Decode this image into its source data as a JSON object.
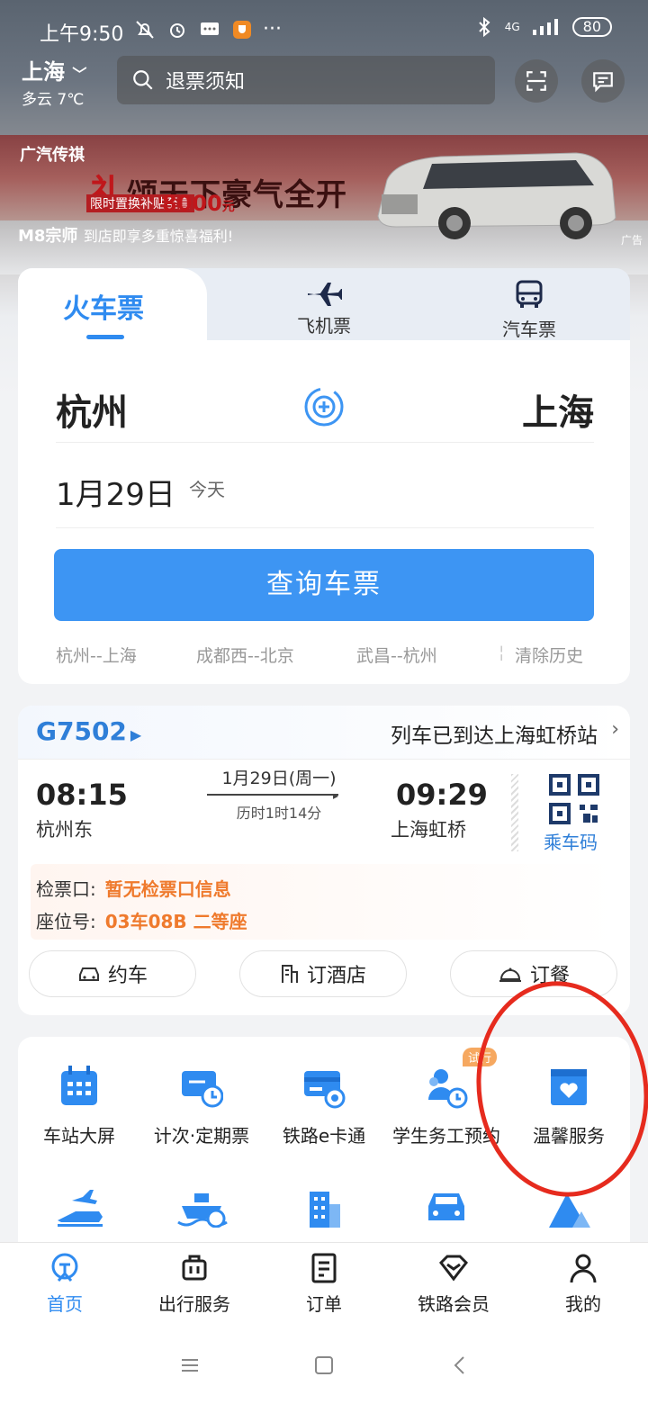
{
  "status": {
    "time": "上午9:50",
    "network": "4G",
    "battery": "80"
  },
  "header": {
    "city": "上海",
    "weather": "多云 7℃",
    "search_placeholder": "退票须知"
  },
  "ad": {
    "brand": "广汽传祺",
    "headline_first": "礼",
    "headline_rest": "颂天下豪气全开",
    "sub": "限时置换补贴至高",
    "amount": "8000",
    "unit": "元",
    "model": "M8宗师",
    "model_tagline": "到店即享多重惊喜福利!",
    "tag": "广告"
  },
  "ticket_tabs": {
    "train": "火车票",
    "plane": "飞机票",
    "bus": "汽车票"
  },
  "search_form": {
    "from": "杭州",
    "to": "上海",
    "date": "1月29日",
    "date_note": "今天",
    "query_button": "查询车票",
    "history": [
      "杭州--上海",
      "成都西--北京",
      "武昌--杭州"
    ],
    "clear_history": "清除历史"
  },
  "trip": {
    "train_no": "G7502",
    "status": "列车已到达上海虹桥站",
    "dep_time": "08:15",
    "dep_station": "杭州东",
    "date": "1月29日(周一)",
    "duration": "历时1时14分",
    "arr_time": "09:29",
    "arr_station": "上海虹桥",
    "qr_label": "乘车码",
    "gate_label": "检票口:",
    "gate_value": "暂无检票口信息",
    "seat_label": "座位号:",
    "seat_value": "03车08B 二等座",
    "actions": [
      "约车",
      "订酒店",
      "订餐"
    ]
  },
  "services": {
    "items": [
      "车站大屏",
      "计次·定期票",
      "铁路e卡通",
      "学生务工预约",
      "温馨服务"
    ],
    "trial_badge": "试行"
  },
  "bottom_nav": [
    "首页",
    "出行服务",
    "订单",
    "铁路会员",
    "我的"
  ],
  "colors": {
    "accent": "#2f8bf0",
    "orange": "#ef7a2d",
    "annotation": "#e62b1e"
  }
}
